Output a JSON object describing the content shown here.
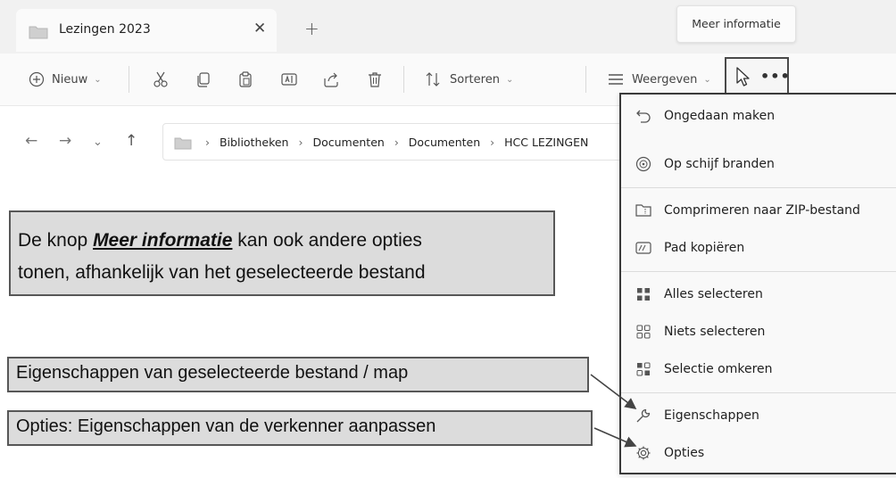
{
  "tab": {
    "title": "Lezingen 2023",
    "close_glyph": "✕",
    "new_tab_glyph": "+"
  },
  "tooltip": {
    "text": "Meer informatie"
  },
  "toolbar": {
    "new_label": "Nieuw",
    "sort_label": "Sorteren",
    "view_label": "Weergeven",
    "see_more_glyph": "•••",
    "icons": [
      "plus-circle-icon",
      "cut-icon",
      "copy-icon",
      "paste-icon",
      "rename-icon",
      "share-icon",
      "delete-icon",
      "sort-icon",
      "view-icon",
      "cursor-icon"
    ]
  },
  "address": {
    "crumbs": [
      "Bibliotheken",
      "Documenten",
      "Documenten",
      "HCC LEZINGEN"
    ],
    "separator": "›"
  },
  "notes": {
    "note1_prefix": "De knop ",
    "note1_emphasis": "Meer informatie",
    "note1_suffix": " kan ook andere opties",
    "note1_line2": "tonen, afhankelijk van het geselecteerde bestand",
    "note2": "Eigenschappen van geselecteerde bestand / map",
    "note3": "Opties: Eigenschappen van de verkenner aanpassen"
  },
  "menu": {
    "items": [
      {
        "label": "Ongedaan maken",
        "icon": "undo-icon"
      },
      {
        "label": "Op schijf branden",
        "icon": "disc-icon"
      },
      {
        "label": "Comprimeren naar ZIP-bestand",
        "icon": "zip-folder-icon"
      },
      {
        "label": "Pad kopiëren",
        "icon": "copy-path-icon"
      },
      {
        "label": "Alles selecteren",
        "icon": "select-all-icon"
      },
      {
        "label": "Niets selecteren",
        "icon": "select-none-icon"
      },
      {
        "label": "Selectie omkeren",
        "icon": "invert-selection-icon"
      },
      {
        "label": "Eigenschappen",
        "icon": "wrench-icon"
      },
      {
        "label": "Opties",
        "icon": "gear-icon"
      }
    ]
  },
  "colors": {
    "note_bg": "#dcdcdc",
    "note_border": "#575757",
    "menu_border": "#3a3a3a",
    "folder": "#c9c9c9"
  }
}
